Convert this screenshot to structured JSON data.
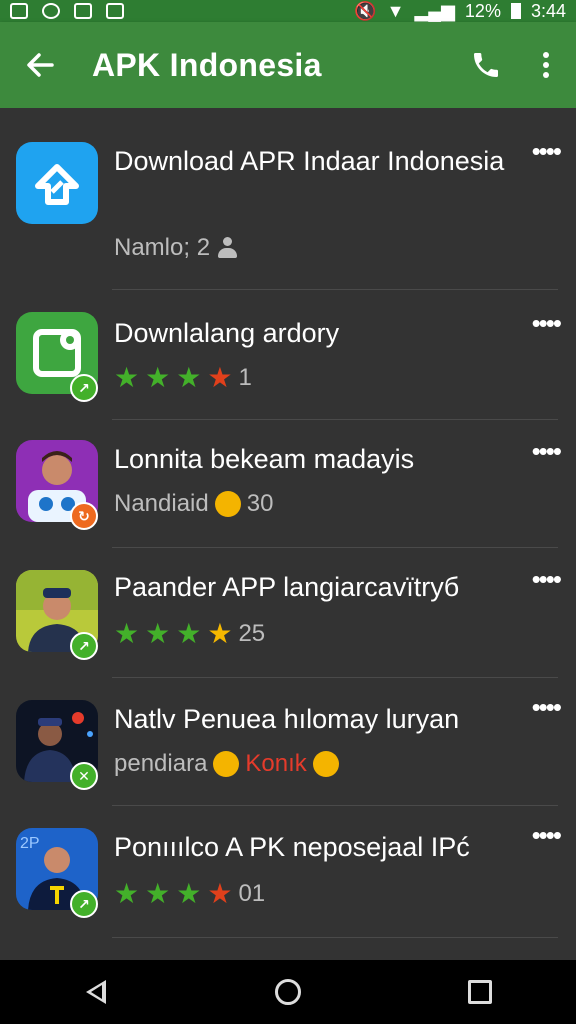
{
  "status_bar": {
    "battery": "12%",
    "time": "3:44"
  },
  "app_bar": {
    "back_icon": "arrow-left-icon",
    "title": "APK Indonesia",
    "call_icon": "phone-icon",
    "menu_icon": "overflow-menu-icon"
  },
  "colors": {
    "app_bar": "#3d8a3d",
    "list_bg": "#333333",
    "star_green": "#43b02a",
    "star_red": "#e1401b",
    "star_yellow": "#f5b800"
  },
  "items": [
    {
      "title": "Download APR Indaar Indonesia",
      "meta_text": "Namlo; 2",
      "meta_icon": "person-icon",
      "more": "••••"
    },
    {
      "title": "Downlalang ardory",
      "rating_value": "1",
      "more": "••••"
    },
    {
      "title": "Lonnita bekeam madayis",
      "meta_text": "Nandiaid",
      "meta_count": "30",
      "meta_icon": "laughing-emoji-icon",
      "more": "••••"
    },
    {
      "title": "Paander APP langiarcavïtryб",
      "rating_value": "25",
      "more": "••••"
    },
    {
      "title": "Natlv Penuea hılomay luryan",
      "meta_text": "pendiara",
      "meta_red": "Konık",
      "more": "••••"
    },
    {
      "title": "Ponııılco A PK neposejaal  IPć",
      "rating_value": "01",
      "more": "••••"
    }
  ]
}
